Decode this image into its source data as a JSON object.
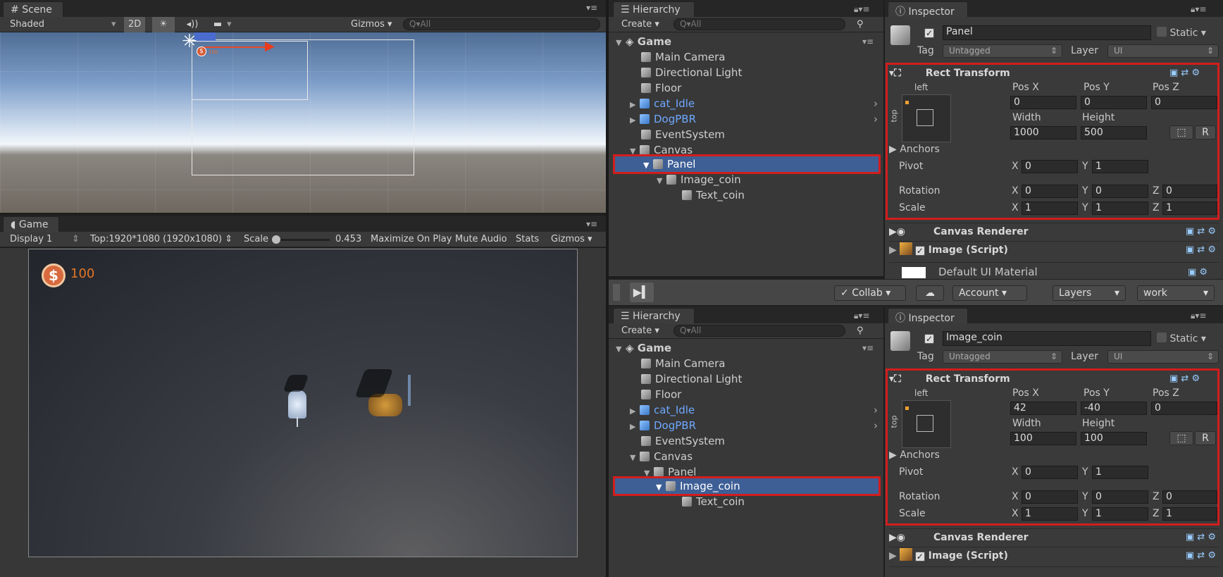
{
  "scene": {
    "tab": "Scene",
    "shading": "Shaded",
    "mode2d": "2D",
    "gizmos": "Gizmos",
    "search_placeholder": "Q▾All",
    "coin_small_label": "100"
  },
  "game": {
    "tab": "Game",
    "display": "Display 1",
    "resolution": "Top:1920*1080 (1920x1080)",
    "scale_label": "Scale",
    "scale_value": "0.453",
    "maximize": "Maximize On Play",
    "mute": "Mute Audio",
    "stats": "Stats",
    "gizmos": "Gizmos",
    "coin_value": "100"
  },
  "toolbar": {
    "collab": "Collab",
    "account": "Account",
    "layers": "Layers",
    "layout": "work"
  },
  "hierarchy_top": {
    "tab": "Hierarchy",
    "create": "Create",
    "search": "Q▾All",
    "items": [
      {
        "label": "Game"
      },
      {
        "label": "Main Camera"
      },
      {
        "label": "Directional Light"
      },
      {
        "label": "Floor"
      },
      {
        "label": "cat_Idle"
      },
      {
        "label": "DogPBR"
      },
      {
        "label": "EventSystem"
      },
      {
        "label": "Canvas"
      },
      {
        "label": "Panel"
      },
      {
        "label": "Image_coin"
      },
      {
        "label": "Text_coin"
      }
    ]
  },
  "hierarchy_bottom": {
    "tab": "Hierarchy",
    "create": "Create",
    "search": "Q▾All",
    "items": [
      {
        "label": "Game"
      },
      {
        "label": "Main Camera"
      },
      {
        "label": "Directional Light"
      },
      {
        "label": "Floor"
      },
      {
        "label": "cat_Idle"
      },
      {
        "label": "DogPBR"
      },
      {
        "label": "EventSystem"
      },
      {
        "label": "Canvas"
      },
      {
        "label": "Panel"
      },
      {
        "label": "Image_coin"
      },
      {
        "label": "Text_coin"
      }
    ]
  },
  "inspector_top": {
    "tab": "Inspector",
    "name": "Panel",
    "static": "Static",
    "tag_label": "Tag",
    "tag": "Untagged",
    "layer_label": "Layer",
    "layer": "UI",
    "rect_transform": "Rect Transform",
    "anchor_h": "left",
    "anchor_v": "top",
    "pos_x_label": "Pos X",
    "pos_y_label": "Pos Y",
    "pos_z_label": "Pos Z",
    "pos_x": "0",
    "pos_y": "0",
    "pos_z": "0",
    "width_label": "Width",
    "height_label": "Height",
    "width": "1000",
    "height": "500",
    "anchors": "Anchors",
    "pivot": "Pivot",
    "pivot_x": "0",
    "pivot_y": "1",
    "rotation": "Rotation",
    "rot_x": "0",
    "rot_y": "0",
    "rot_z": "0",
    "scale": "Scale",
    "scale_x": "1",
    "scale_y": "1",
    "scale_z": "1",
    "x": "X",
    "y": "Y",
    "z": "Z",
    "r_btn": "R",
    "canvas_renderer": "Canvas Renderer",
    "image_script": "Image (Script)",
    "material": "Default UI Material"
  },
  "inspector_bottom": {
    "tab": "Inspector",
    "name": "Image_coin",
    "static": "Static",
    "tag_label": "Tag",
    "tag": "Untagged",
    "layer_label": "Layer",
    "layer": "UI",
    "rect_transform": "Rect Transform",
    "anchor_h": "left",
    "anchor_v": "top",
    "pos_x_label": "Pos X",
    "pos_y_label": "Pos Y",
    "pos_z_label": "Pos Z",
    "pos_x": "42",
    "pos_y": "-40",
    "pos_z": "0",
    "width_label": "Width",
    "height_label": "Height",
    "width": "100",
    "height": "100",
    "anchors": "Anchors",
    "pivot": "Pivot",
    "pivot_x": "0",
    "pivot_y": "1",
    "rotation": "Rotation",
    "rot_x": "0",
    "rot_y": "0",
    "rot_z": "0",
    "scale": "Scale",
    "scale_x": "1",
    "scale_y": "1",
    "scale_z": "1",
    "x": "X",
    "y": "Y",
    "z": "Z",
    "r_btn": "R",
    "canvas_renderer": "Canvas Renderer",
    "image_script": "Image (Script)"
  }
}
